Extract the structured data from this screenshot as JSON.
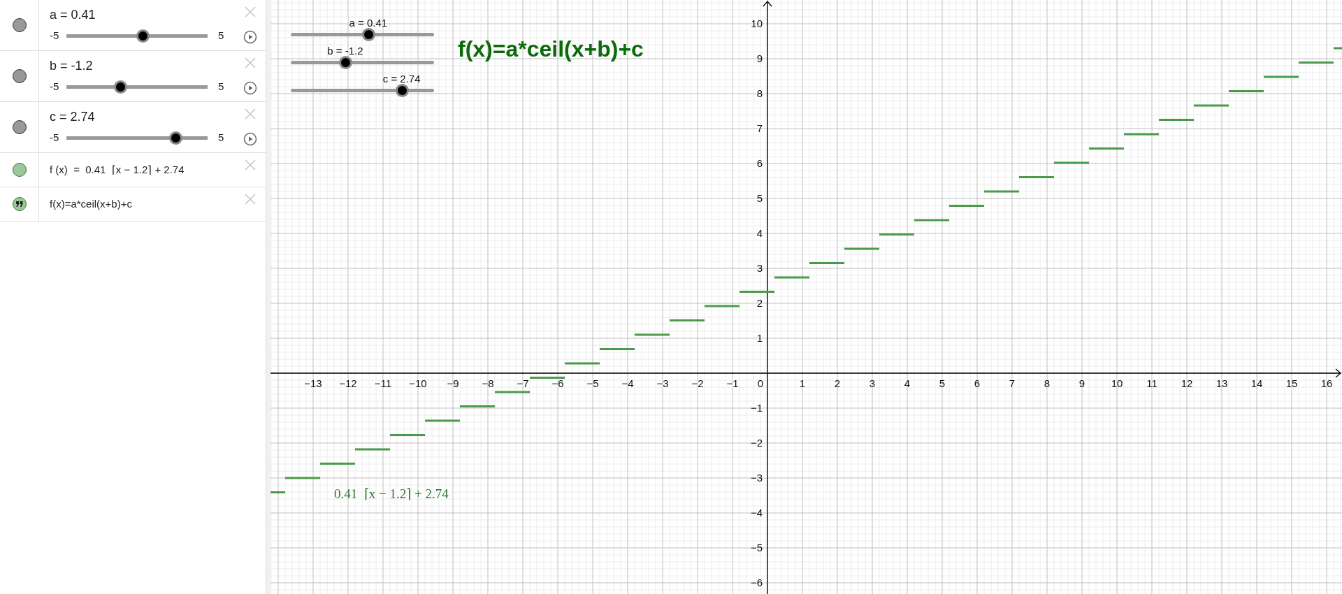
{
  "algebra": {
    "items": [
      {
        "kind": "slider",
        "color": "#999999",
        "label": "a = 0.41",
        "min": "-5",
        "max": "5",
        "level": 0.541
      },
      {
        "kind": "slider",
        "color": "#999999",
        "label": "b = -1.2",
        "min": "-5",
        "max": "5",
        "level": 0.38
      },
      {
        "kind": "slider",
        "color": "#999999",
        "label": "c = 2.74",
        "min": "-5",
        "max": "5",
        "level": 0.774
      },
      {
        "kind": "function",
        "color": "#9cc79c",
        "formula": "f (x)  =  0.41  ⌈x − 1.2⌉ + 2.74"
      },
      {
        "kind": "text",
        "color": "#9cc79c",
        "formula": "f(x)=a*ceil(x+b)+c"
      }
    ]
  },
  "graphics": {
    "sliders": [
      {
        "label": "a = 0.41",
        "level": 0.541
      },
      {
        "label": "b = -1.2",
        "level": 0.38
      },
      {
        "label": "c = 2.74",
        "level": 0.774
      }
    ],
    "text": "f(x)=a*ceil(x+b)+c",
    "origin_label": "0",
    "chart_data": {
      "type": "line",
      "grid": true,
      "xlim": [
        -14.22,
        16.44
      ],
      "ylim": [
        -6.32,
        10.68
      ],
      "xticks": [
        {
          "value": -13,
          "label": "−13"
        },
        {
          "value": -12,
          "label": "−12"
        },
        {
          "value": -11,
          "label": "−11"
        },
        {
          "value": -10,
          "label": "−10"
        },
        {
          "value": -9,
          "label": "−9"
        },
        {
          "value": -8,
          "label": "−8"
        },
        {
          "value": -7,
          "label": "−7"
        },
        {
          "value": -6,
          "label": "−6"
        },
        {
          "value": -5,
          "label": "−5"
        },
        {
          "value": -4,
          "label": "−4"
        },
        {
          "value": -3,
          "label": "−3"
        },
        {
          "value": -2,
          "label": "−2"
        },
        {
          "value": -1,
          "label": "−1"
        },
        1,
        2,
        3,
        4,
        5,
        6,
        7,
        8,
        9,
        10,
        11,
        12,
        13,
        14,
        15,
        16
      ],
      "yticks": [
        {
          "value": -6,
          "label": "−6"
        },
        {
          "value": -5,
          "label": "−5"
        },
        {
          "value": -4,
          "label": "−4"
        },
        {
          "value": -3,
          "label": "−3"
        },
        {
          "value": -2,
          "label": "−2"
        },
        {
          "value": -1,
          "label": "−1"
        },
        1,
        2,
        3,
        4,
        5,
        6,
        7,
        8,
        9,
        10
      ],
      "x": [
        -14.22,
        -13.8,
        -13.8,
        -12.8,
        -12.8,
        -11.8,
        -11.8,
        -10.8,
        -10.8,
        -9.8,
        -9.8,
        -8.8,
        -8.8,
        -7.8,
        -7.8,
        -6.8,
        -6.8,
        -5.8,
        -5.8,
        -4.8,
        -4.8,
        -3.8,
        -3.8,
        -2.8,
        -2.8,
        -1.8,
        -1.8,
        -0.8,
        -0.8,
        0.2,
        0.2,
        1.2,
        1.2,
        2.2,
        2.2,
        3.2,
        3.2,
        4.2,
        4.2,
        5.2,
        5.2,
        6.2,
        6.2,
        7.2,
        7.2,
        8.2,
        8.2,
        9.2,
        9.2,
        10.2,
        10.2,
        11.2,
        11.2,
        12.2,
        12.2,
        13.2,
        13.2,
        14.2,
        14.2,
        15.2,
        15.2,
        16.2,
        16.2,
        16.44
      ],
      "series": [
        {
          "color": "#4b9a4b",
          "values": [
            -3.41,
            -3.41,
            -3.0,
            -3.0,
            -2.59,
            -2.59,
            -2.18,
            -2.18,
            -1.77,
            -1.77,
            -1.36,
            -1.36,
            -0.95,
            -0.95,
            -0.54,
            -0.54,
            -0.13,
            -0.13,
            0.28,
            0.28,
            0.69,
            0.69,
            1.1,
            1.1,
            1.51,
            1.51,
            1.92,
            1.92,
            2.33,
            2.33,
            2.74,
            2.74,
            3.15,
            3.15,
            3.56,
            3.56,
            3.97,
            3.97,
            4.38,
            4.38,
            4.79,
            4.79,
            5.2,
            5.2,
            5.61,
            5.61,
            6.02,
            6.02,
            6.43,
            6.43,
            6.84,
            6.84,
            7.25,
            7.25,
            7.66,
            7.66,
            8.07,
            8.07,
            8.48,
            8.48,
            8.89,
            8.89,
            9.3,
            9.3
          ]
        }
      ],
      "annotations": [
        "0.41  ⌈x − 1.2⌉ + 2.74"
      ]
    }
  }
}
